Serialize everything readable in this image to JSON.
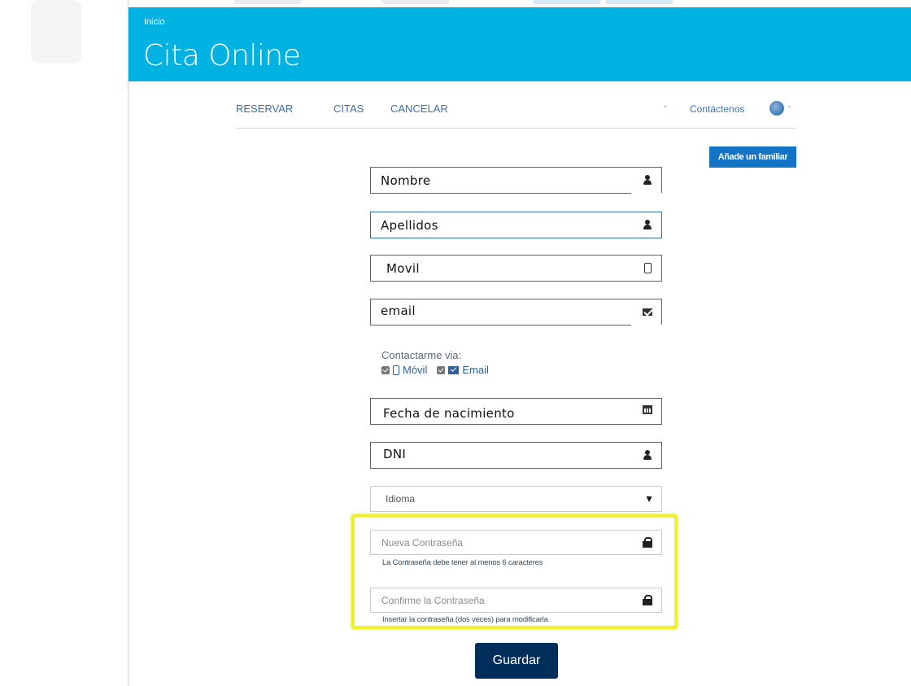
{
  "header": {
    "breadcrumb": "Inicio",
    "title": "Cita Online"
  },
  "nav": {
    "items": [
      "RESERVAR",
      "CITAS",
      "CANCELAR"
    ],
    "dash": "-",
    "contact": "Contáctenos",
    "lang_caret": "-"
  },
  "family_button": "Añade un familiar",
  "form": {
    "nombre": "Nombre",
    "apellidos": "Apellidos",
    "movil": "Movil",
    "email": "email",
    "contact_via": {
      "label": "Contactarme via:",
      "options": [
        "Móvil",
        "Email"
      ]
    },
    "fecha": "Fecha de nacimiento",
    "dni": "DNI",
    "idioma": "Idioma",
    "new_password": {
      "placeholder": "Nueva Contraseña",
      "help": "La Contraseña debe tener al menos 6 caracteres"
    },
    "confirm_password": {
      "placeholder": "Confirme la Contraseña",
      "help": "Insertar la contraseña (dos veces) para modificarla"
    },
    "save": "Guardar"
  },
  "colors": {
    "header": "#00b2e2",
    "nav_link": "#3d6fae",
    "primary_button": "#1373c4",
    "save_button": "#002e5b",
    "highlight": "#f0f028"
  }
}
